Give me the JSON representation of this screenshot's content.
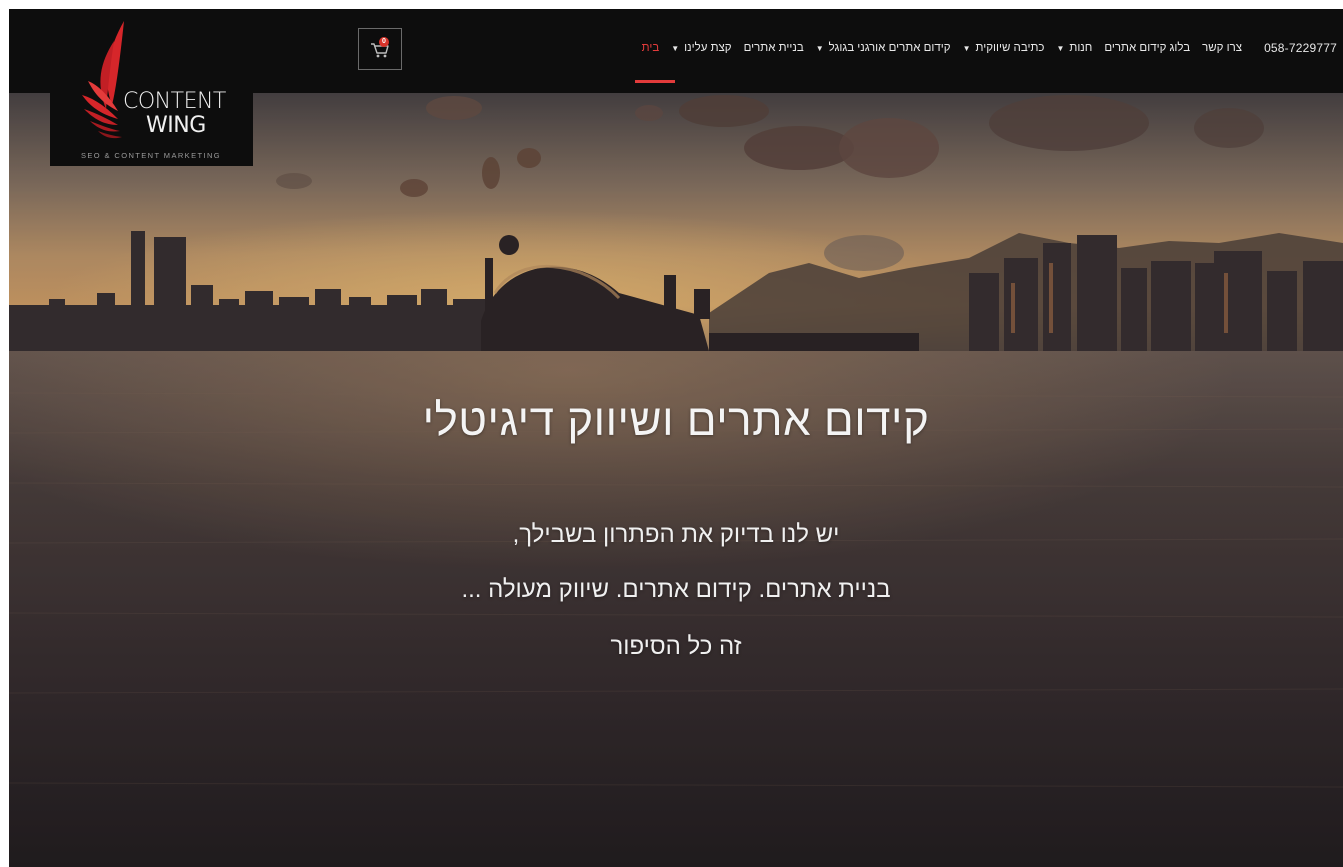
{
  "nav": {
    "items": [
      {
        "label": "בית",
        "active": true,
        "dropdown": false
      },
      {
        "label": "קצת עלינו",
        "dropdown": true
      },
      {
        "label": "בניית אתרים",
        "dropdown": false
      },
      {
        "label": "קידום אתרים אורגני בגוגל",
        "dropdown": true
      },
      {
        "label": "כתיבה שיווקית",
        "dropdown": true
      },
      {
        "label": "חנות",
        "dropdown": true
      },
      {
        "label": "בלוג קידום אתרים",
        "dropdown": false
      },
      {
        "label": "צרו קשר",
        "dropdown": false
      }
    ],
    "phone": "058-7229777"
  },
  "cart": {
    "count": "0",
    "icon": "cart-icon"
  },
  "logo": {
    "line1": "CONTENT",
    "line2": "WING",
    "tagline": "SEO & CONTENT MARKETING",
    "icon": "wing-icon"
  },
  "hero": {
    "title": "קידום אתרים ושיווק דיגיטלי",
    "lines": [
      "יש לנו בדיוק את הפתרון בשבילך,",
      "בניית אתרים. קידום אתרים. שיווק מעולה ...",
      "זה כל הסיפור"
    ]
  },
  "colors": {
    "accent": "#e23b3b",
    "topbar": "#0d0d0d",
    "text": "#f0f0f0"
  }
}
